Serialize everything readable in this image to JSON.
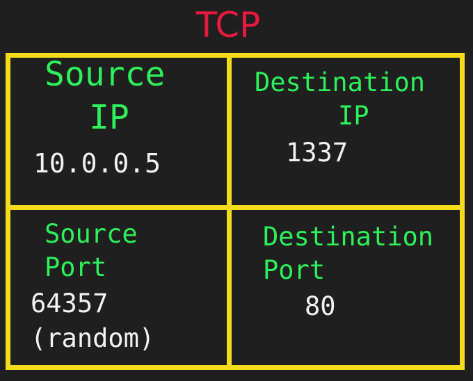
{
  "title": "TCP",
  "cells": [
    {
      "label_line1": "Source",
      "label_line2": "IP",
      "value_line1": "10.0.0.5",
      "value_line2": ""
    },
    {
      "label_line1": "Destination",
      "label_line2": "IP",
      "value_line1": "1337",
      "value_line2": ""
    },
    {
      "label_line1": "Source",
      "label_line2": "Port",
      "value_line1": "64357",
      "value_line2": "(random)"
    },
    {
      "label_line1": "Destination",
      "label_line2": "Port",
      "value_line1": "80",
      "value_line2": ""
    }
  ],
  "colors": {
    "background": "#1f1f1f",
    "title": "#e8193f",
    "border": "#f5dc1a",
    "label": "#2df05a",
    "value": "#f2f2f2"
  }
}
